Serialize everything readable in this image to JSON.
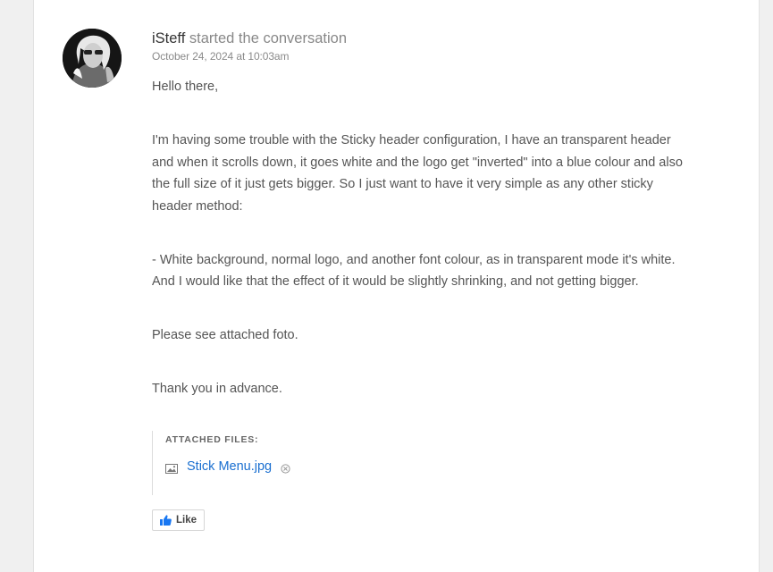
{
  "post": {
    "author": "iSteff",
    "action": "started the conversation",
    "timestamp": "October 24, 2024 at 10:03am",
    "paragraphs": [
      "Hello there,",
      "I'm having some trouble with the Sticky header configuration, I have an transparent header and when it scrolls down, it goes white and the logo get \"inverted\" into a blue colour and also the full size of it just gets bigger. So I just want to have it very simple as any other sticky header method:",
      "- White background, normal logo, and another font colour, as in transparent mode it's white. And I would like that the effect of it would be slightly shrinking, and not getting bigger.",
      "Please see attached foto.",
      "Thank you in advance."
    ]
  },
  "attachments": {
    "title": "ATTACHED FILES:",
    "files": [
      {
        "name": "Stick Menu.jpg",
        "icon": "image-icon",
        "remove_icon": "remove-icon"
      }
    ]
  },
  "actions": {
    "like_label": "Like",
    "like_icon": "thumbs-up-icon"
  },
  "colors": {
    "link": "#1a6fd0",
    "like_icon": "#1877f2",
    "text": "#555555"
  }
}
